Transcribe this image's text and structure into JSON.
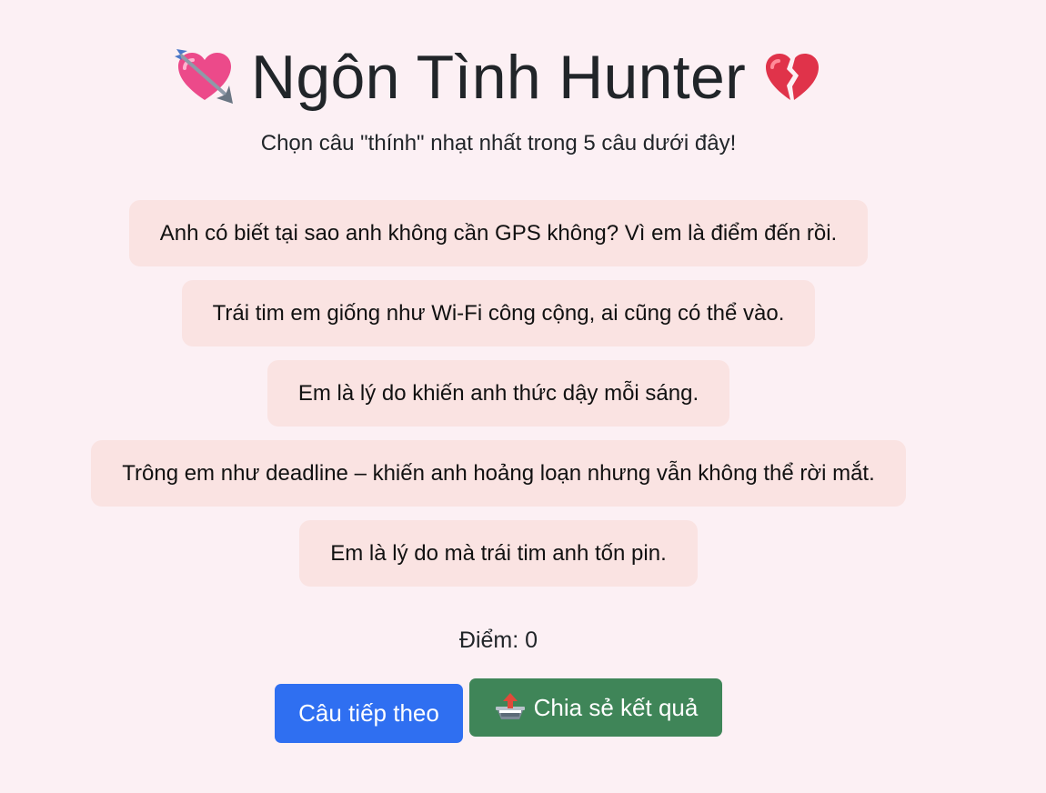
{
  "header": {
    "title": "Ngôn Tình Hunter",
    "left_icon": "heart-with-arrow-icon",
    "right_icon": "broken-heart-icon",
    "subtitle": "Chọn câu \"thính\" nhạt nhất trong 5 câu dưới đây!"
  },
  "options": [
    {
      "label": "Anh có biết tại sao anh không cần GPS không? Vì em là điểm đến rồi."
    },
    {
      "label": "Trái tim em giống như Wi-Fi công cộng, ai cũng có thể vào."
    },
    {
      "label": "Em là lý do khiến anh thức dậy mỗi sáng."
    },
    {
      "label": "Trông em như deadline – khiến anh hoảng loạn nhưng vẫn không thể rời mắt."
    },
    {
      "label": "Em là lý do mà trái tim anh tốn pin."
    }
  ],
  "score": {
    "text": "Điểm: 0"
  },
  "buttons": {
    "next_label": "Câu tiếp theo",
    "share_label": "Chia sẻ kết quả",
    "share_icon": "outbox-tray-icon"
  },
  "colors": {
    "background": "#fcf0f4",
    "option_bg": "#fae3e2",
    "primary": "#2f6ff1",
    "success": "#3f8558"
  }
}
